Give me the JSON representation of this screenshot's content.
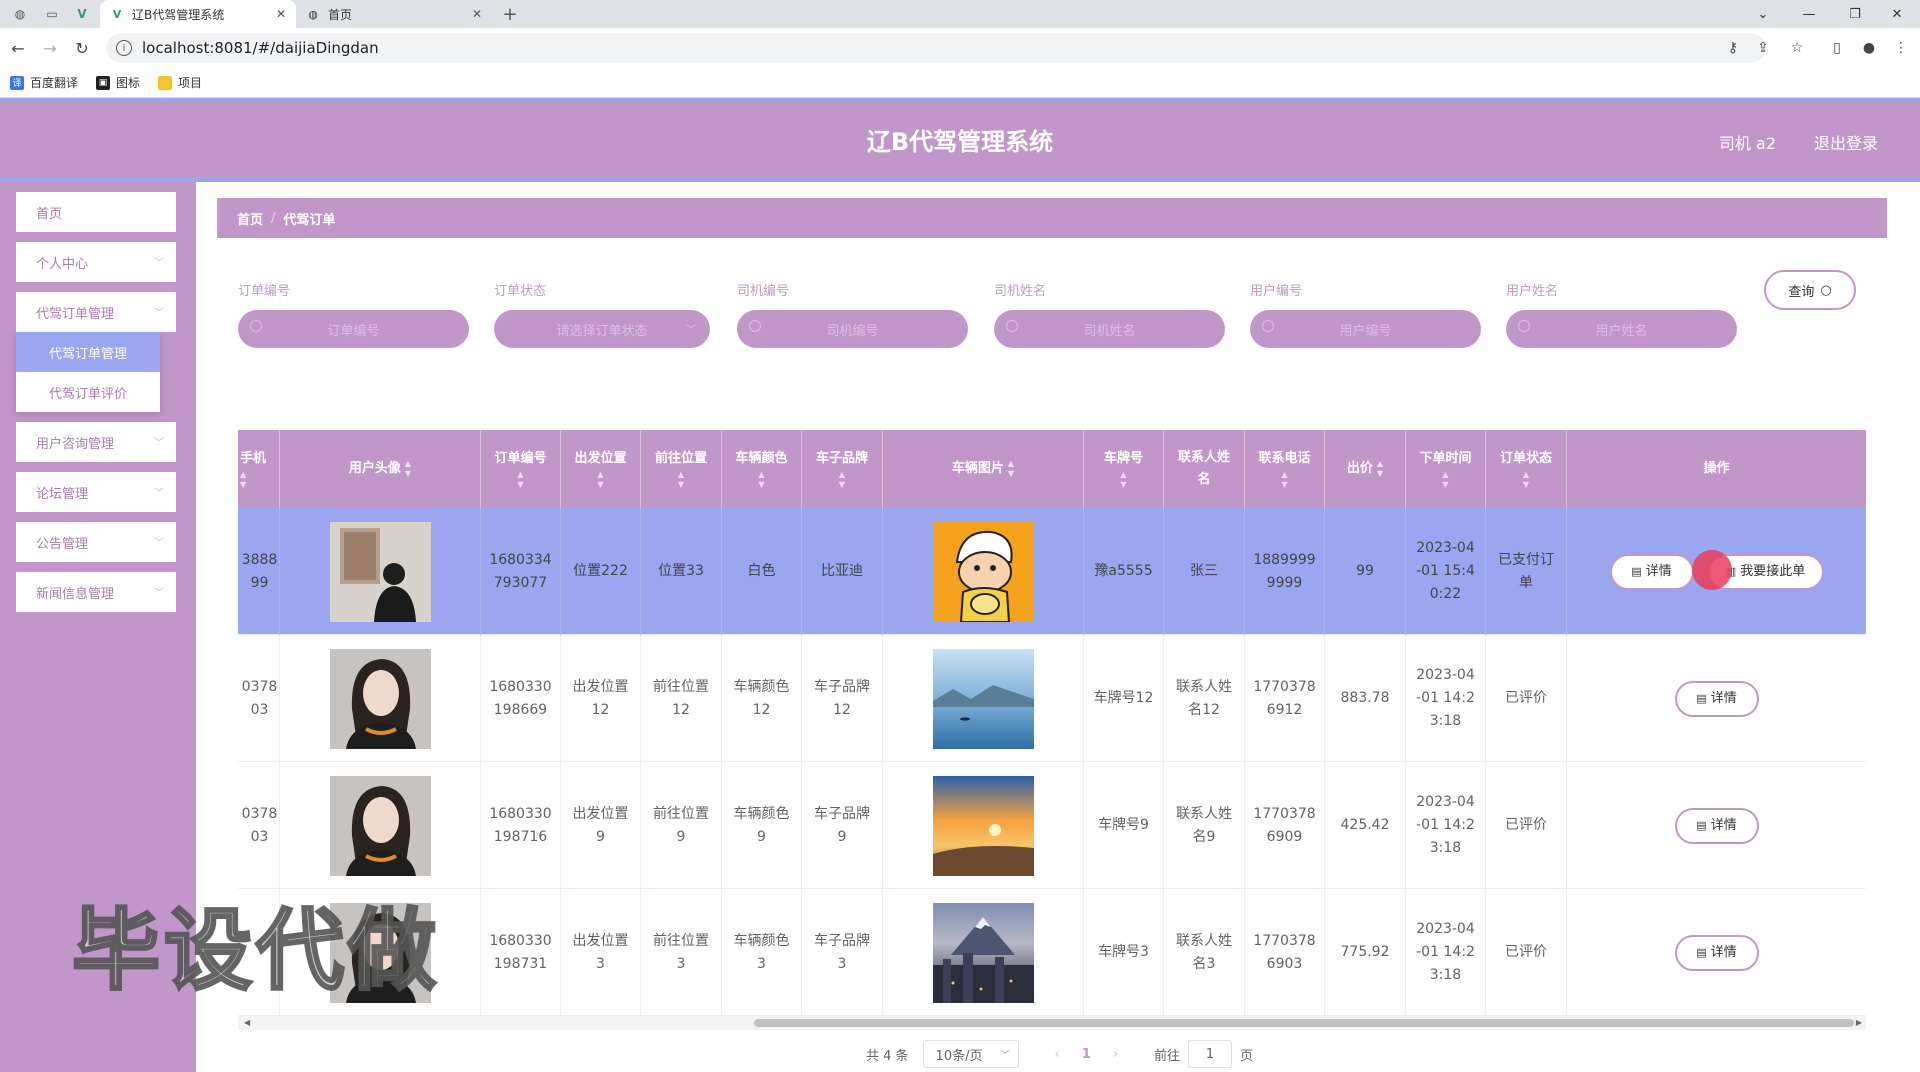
{
  "browser": {
    "tabs": [
      {
        "title": "辽B代驾管理系统",
        "active": true
      },
      {
        "title": "首页",
        "active": false
      }
    ],
    "url": "localhost:8081/#/daijiaDingdan",
    "bookmarks": [
      "百度翻译",
      "图标",
      "项目"
    ]
  },
  "header": {
    "title": "辽B代驾管理系统",
    "user": "司机 a2",
    "logout": "退出登录"
  },
  "sidebar": {
    "items": [
      {
        "label": "首页"
      },
      {
        "label": "个人中心"
      },
      {
        "label": "代驾订单管理"
      },
      {
        "label": "用户咨询管理"
      },
      {
        "label": "论坛管理"
      },
      {
        "label": "公告管理"
      },
      {
        "label": "新闻信息管理"
      }
    ],
    "submenu": [
      {
        "label": "代驾订单管理"
      },
      {
        "label": "代驾订单评价"
      }
    ]
  },
  "breadcrumb": {
    "home": "首页",
    "current": "代驾订单"
  },
  "search": {
    "fields": [
      {
        "label": "订单编号",
        "placeholder": "订单编号"
      },
      {
        "label": "订单状态",
        "placeholder": "请选择订单状态"
      },
      {
        "label": "司机编号",
        "placeholder": "司机编号"
      },
      {
        "label": "司机姓名",
        "placeholder": "司机姓名"
      },
      {
        "label": "用户编号",
        "placeholder": "用户编号"
      },
      {
        "label": "用户姓名",
        "placeholder": "用户姓名"
      }
    ],
    "query_label": "查询"
  },
  "table": {
    "headers": {
      "phone": "手机",
      "avatar": "用户头像",
      "order_no": "订单编号",
      "start": "出发位置",
      "dest": "前往位置",
      "car_color": "车辆颜色",
      "car_brand": "车子品牌",
      "car_photo": "车辆图片",
      "plate": "车牌号",
      "contact_name": "联系人姓名",
      "contact_phone": "联系电话",
      "price": "出价",
      "order_time": "下单时间",
      "status": "订单状态",
      "actions": "操作"
    },
    "rows": [
      {
        "phone": "3888 99",
        "order_no": "1680334 793077",
        "start": "位置222",
        "dest": "位置33",
        "car_color": "白色",
        "car_brand": "比亚迪",
        "plate": "豫a5555",
        "contact_name": "张三",
        "contact_phone": "1889999 9999",
        "price": "99",
        "order_time": "2023-04 -01 15:4 0:22",
        "status": "已支付订 单",
        "detail": "详情",
        "accept": "我要接此单"
      },
      {
        "phone": "0378 03",
        "order_no": "1680330 198669",
        "start": "出发位置 12",
        "dest": "前往位置 12",
        "car_color": "车辆颜色 12",
        "car_brand": "车子品牌 12",
        "plate": "车牌号12",
        "contact_name": "联系人姓 名12",
        "contact_phone": "1770378 6912",
        "price": "883.78",
        "order_time": "2023-04 -01 14:2 3:18",
        "status": "已评价",
        "detail": "详情"
      },
      {
        "phone": "0378 03",
        "order_no": "1680330 198716",
        "start": "出发位置 9",
        "dest": "前往位置 9",
        "car_color": "车辆颜色 9",
        "car_brand": "车子品牌 9",
        "plate": "车牌号9",
        "contact_name": "联系人姓 名9",
        "contact_phone": "1770378 6909",
        "price": "425.42",
        "order_time": "2023-04 -01 14:2 3:18",
        "status": "已评价",
        "detail": "详情"
      },
      {
        "phone": "",
        "order_no": "1680330 198731",
        "start": "出发位置 3",
        "dest": "前往位置 3",
        "car_color": "车辆颜色 3",
        "car_brand": "车子品牌 3",
        "plate": "车牌号3",
        "contact_name": "联系人姓 名3",
        "contact_phone": "1770378 6903",
        "price": "775.92",
        "order_time": "2023-04 -01 14:2 3:18",
        "status": "已评价",
        "detail": "详情"
      }
    ]
  },
  "pagination": {
    "total": "共 4 条",
    "page_size": "10条/页",
    "current_page": "1",
    "goto_prefix": "前往",
    "goto_value": "1",
    "goto_suffix": "页"
  },
  "watermark": "毕设代做",
  "colors": {
    "theme": "#c197c9",
    "accent": "#9aa6f0"
  }
}
